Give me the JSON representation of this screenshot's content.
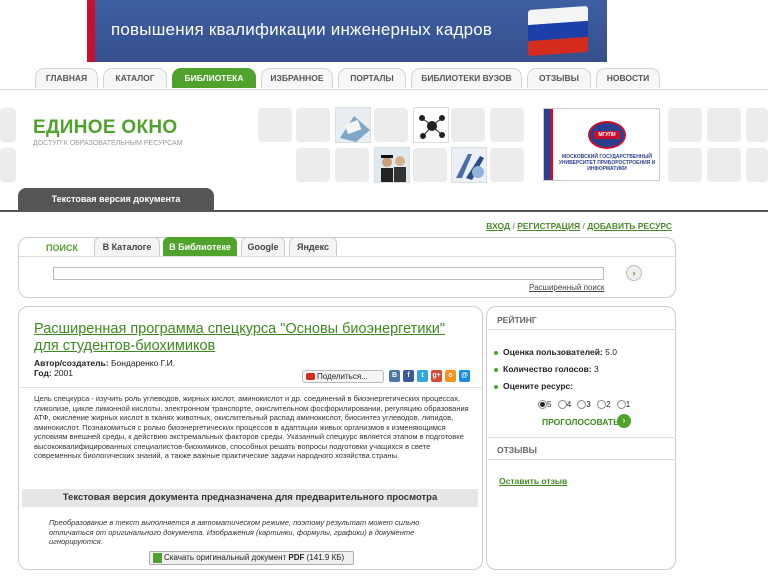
{
  "banner": {
    "text": "повышения квалификации инженерных кадров"
  },
  "nav": [
    {
      "label": "ГЛАВНАЯ"
    },
    {
      "label": "КАТАЛОГ"
    },
    {
      "label": "БИБЛИОТЕКА"
    },
    {
      "label": "ИЗБРАННОЕ"
    },
    {
      "label": "ПОРТАЛЫ"
    },
    {
      "label": "БИБЛИОТЕКИ ВУЗОВ"
    },
    {
      "label": "ОТЗЫВЫ"
    },
    {
      "label": "НОВОСТИ"
    }
  ],
  "nav_active": "БИБЛИОТЕКА",
  "logo": {
    "title": "ЕДИНОЕ ОКНО",
    "subtitle": "ДОСТУП К ОБРАЗОВАТЕЛЬНЫМ РЕСУРСАМ"
  },
  "uni": {
    "emblem": "МГУПИ",
    "name": "МОСКОВСКИЙ ГОСУДАРСТВЕННЫЙ УНИВЕРСИТЕТ ПРИБОРОСТРОЕНИЯ И ИНФОРМАТИКИ"
  },
  "text_tab": "Текстовая версия документа",
  "top_links": {
    "login": "ВХОД",
    "register": "РЕГИСТРАЦИЯ",
    "add": "ДОБАВИТЬ РЕСУРС",
    "sep": "/"
  },
  "search": {
    "label": "ПОИСК",
    "tabs": [
      "В Каталоге",
      "В Библиотеке",
      "Google",
      "Яндекс"
    ],
    "active_tab": "В Библиотеке",
    "value": "",
    "go": "›",
    "advanced": "Расширенный поиск"
  },
  "doc": {
    "title": "Расширенная программа спецкурса \"Основы биоэнергетики\" для студентов-биохимиков",
    "author_label": "Автор/создатель:",
    "author": "Бондаренко Г.И.",
    "year_label": "Год:",
    "year": "2001",
    "share": "Поделиться...",
    "social": [
      {
        "label": "В",
        "color": "#4a76a8"
      },
      {
        "label": "f",
        "color": "#3b5998"
      },
      {
        "label": "t",
        "color": "#2fa8e0"
      },
      {
        "label": "g+",
        "color": "#d64937"
      },
      {
        "label": "o",
        "color": "#f7931e"
      },
      {
        "label": "@",
        "color": "#168de2"
      }
    ],
    "description": "Цель спецкурса - изучить роль углеводов, жирных кислот, аминокислот и др. соединений в биоэнергетических процессах, гликолизе, цикле лимонной кислоты, электронном транспорте, окислительном фосфорилировании, регуляцию образования АТФ, окисление жирных кислот в тканях животных, окислительный распад аминокислот, биосинтез углеводов, липидов, аминокислот. Познакомиться с ролью биоэнергетических процессов в адаптации живых организмов к изменяющимся условиям внешней среды, к действию экстремальных факторов среды. Указанный спецкурс является этапом в подготовке высококвалифицированных специалистов-биохимиков, способных решать вопросы подготовки учащихся в свете современных биологических знаний, а также важные практические задачи народного хозяйства страны.",
    "notice": "Текстовая версия документа предназначена для предварительного просмотра",
    "note": "Преобразование в текст выполняется в автоматическом режиме, поэтому результат может сильно отличаться от оригинального документа. Изображения (картинки, формулы, графики) в документе игнорируются.",
    "download_prefix": "Скачать оригинальный документ",
    "download_format": "PDF",
    "download_size": "(141.9 КБ)"
  },
  "rating": {
    "title": "РЕЙТИНГ",
    "user_rating_label": "Оценка пользователей:",
    "user_rating": "5.0",
    "votes_label": "Количество голосов:",
    "votes": "3",
    "rate_label": "Оцените ресурс:",
    "options": [
      "5",
      "4",
      "3",
      "2",
      "1"
    ],
    "selected": "5",
    "vote_button": "ПРОГОЛОСОВАТЬ"
  },
  "reviews": {
    "title": "ОТЗЫВЫ",
    "leave": "Оставить отзыв"
  }
}
